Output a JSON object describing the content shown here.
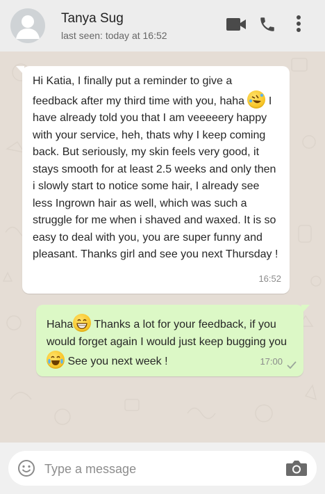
{
  "header": {
    "contact_name": "Tanya Sug",
    "status": "last seen: today at 16:52",
    "icons": [
      "video-call-icon",
      "phone-call-icon",
      "more-menu-icon"
    ]
  },
  "messages": [
    {
      "direction": "incoming",
      "parts": [
        "Hi Katia, I finally put a reminder to give a feedback after my third time with you, haha ",
        {
          "emoji": "rofl-emoji"
        },
        " I have already told you that I am veeeeery happy with your service, heh, thats why I keep coming back. But seriously, my skin feels very good, it stays smooth for at least 2.5 weeks and only then i slowly start to notice some hair, I already see less Ingrown hair as well, which was such a struggle for me when i shaved and waxed. It is so easy to deal with you, you are super funny and pleasant. Thanks girl and see you next Thursday !"
      ],
      "time": "16:52"
    },
    {
      "direction": "outgoing",
      "parts": [
        "Haha",
        {
          "emoji": "grin-emoji"
        },
        " Thanks a lot for your feedback, if you would forget again I would just keep bugging you",
        {
          "emoji": "tears-of-joy-emoji"
        },
        " See you next week !"
      ],
      "time": "17:00",
      "status_icon": "single-check-icon"
    }
  ],
  "composer": {
    "placeholder": "Type a message",
    "value": ""
  },
  "colors": {
    "header_bg": "#ededed",
    "chat_bg": "#e5ddd5",
    "incoming_bubble": "#ffffff",
    "outgoing_bubble": "#dcf8c6",
    "icon_gray": "#4a4a4a"
  }
}
